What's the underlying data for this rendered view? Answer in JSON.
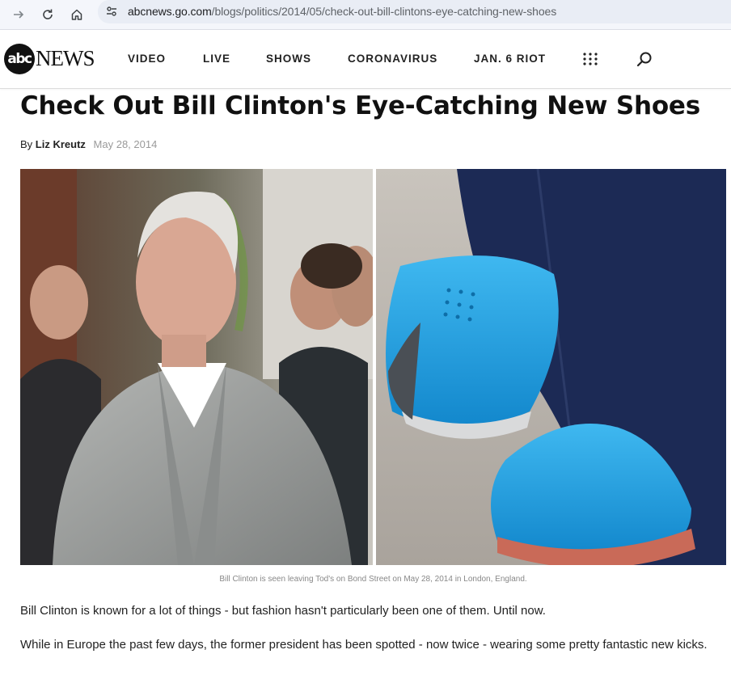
{
  "browser": {
    "url_host": "abcnews.go.com",
    "url_path": "/blogs/politics/2014/05/check-out-bill-clintons-eye-catching-new-shoes"
  },
  "site": {
    "logo_circle": "abc",
    "logo_word": "NEWS",
    "nav": [
      "VIDEO",
      "LIVE",
      "SHOWS",
      "CORONAVIRUS",
      "JAN. 6 RIOT"
    ]
  },
  "article": {
    "headline": "Check Out Bill Clinton's Eye-Catching New Shoes",
    "byline_prefix": "By",
    "author": "Liz Kreutz",
    "date": "May 28, 2014",
    "caption": "Bill Clinton is seen leaving Tod's on Bond Street on May 28, 2014 in London, England.",
    "paragraphs": [
      "Bill Clinton is known for a lot of things - but fashion hasn't particularly been one of them. Until now.",
      "While in Europe the past few days, the former president has been spotted - now twice - wearing some pretty fantastic new kicks."
    ]
  },
  "colors": {
    "shoe_blue": "#1fa3e6",
    "trouser_navy": "#1c2a55",
    "jacket_gray": "#9a9d9c"
  }
}
